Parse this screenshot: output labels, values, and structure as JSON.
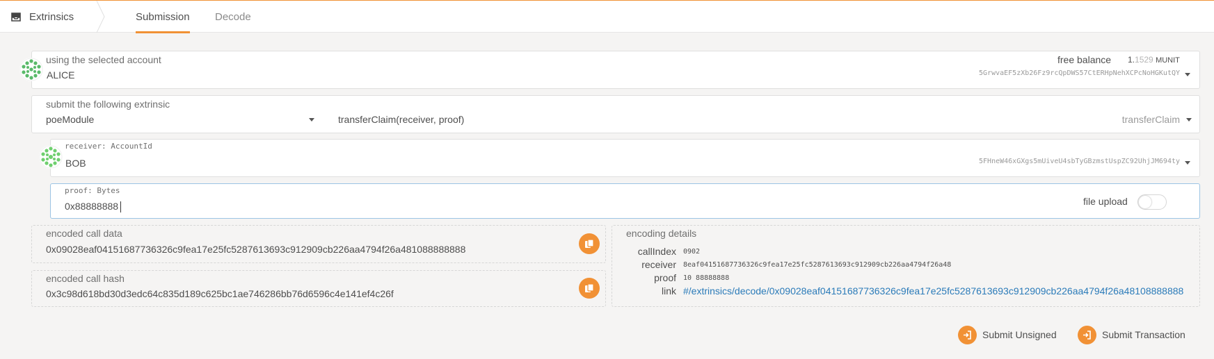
{
  "nav": {
    "section": "Extrinsics",
    "tabs": [
      {
        "label": "Submission",
        "active": true
      },
      {
        "label": "Decode",
        "active": false
      }
    ]
  },
  "account": {
    "label": "using the selected account",
    "name": "ALICE",
    "free_balance_label": "free balance",
    "balance_whole": "1.",
    "balance_fraction": "1529",
    "balance_unit": "MUNIT",
    "address": "5GrwvaEF5zXb26Fz9rcQpDWS57CtERHpNehXCPcNoHGKutQY"
  },
  "extrinsic": {
    "label": "submit the following extrinsic",
    "module": "poeModule",
    "call": "transferClaim(receiver, proof)",
    "call_name": "transferClaim"
  },
  "params": {
    "receiver": {
      "label": "receiver: AccountId",
      "name": "BOB",
      "address": "5FHneW46xGXgs5mUiveU4sbTyGBzmstUspZC92UhjJM694ty"
    },
    "proof": {
      "label": "proof: Bytes",
      "value": "0x88888888",
      "file_upload_label": "file upload",
      "file_upload_enabled": false
    }
  },
  "encoded": {
    "call_data_label": "encoded call data",
    "call_data": "0x09028eaf04151687736326c9fea17e25fc5287613693c912909cb226aa4794f26a481088888888",
    "call_hash_label": "encoded call hash",
    "call_hash": "0x3c98d618bd30d3edc64c835d189c625bc1ae746286bb76d6596c4e141ef4c26f"
  },
  "encoding_details": {
    "label": "encoding details",
    "rows": [
      {
        "key": "callIndex",
        "value": "0902"
      },
      {
        "key": "receiver",
        "value": "8eaf04151687736326c9fea17e25fc5287613693c912909cb226aa4794f26a48"
      },
      {
        "key": "proof",
        "value": "10 88888888"
      }
    ],
    "link_key": "link",
    "link": "#/extrinsics/decode/0x09028eaf04151687736326c9fea17e25fc5287613693c912909cb226aa4794f26a48108888888"
  },
  "actions": {
    "submit_unsigned": "Submit Unsigned",
    "submit_transaction": "Submit Transaction"
  },
  "colors": {
    "accent": "#f19135",
    "link": "#2b7bb9",
    "focus_border": "#9cc4e4"
  },
  "icons": [
    "inbox-icon",
    "copy-icon",
    "sign-in-icon",
    "chevron-down-icon"
  ]
}
